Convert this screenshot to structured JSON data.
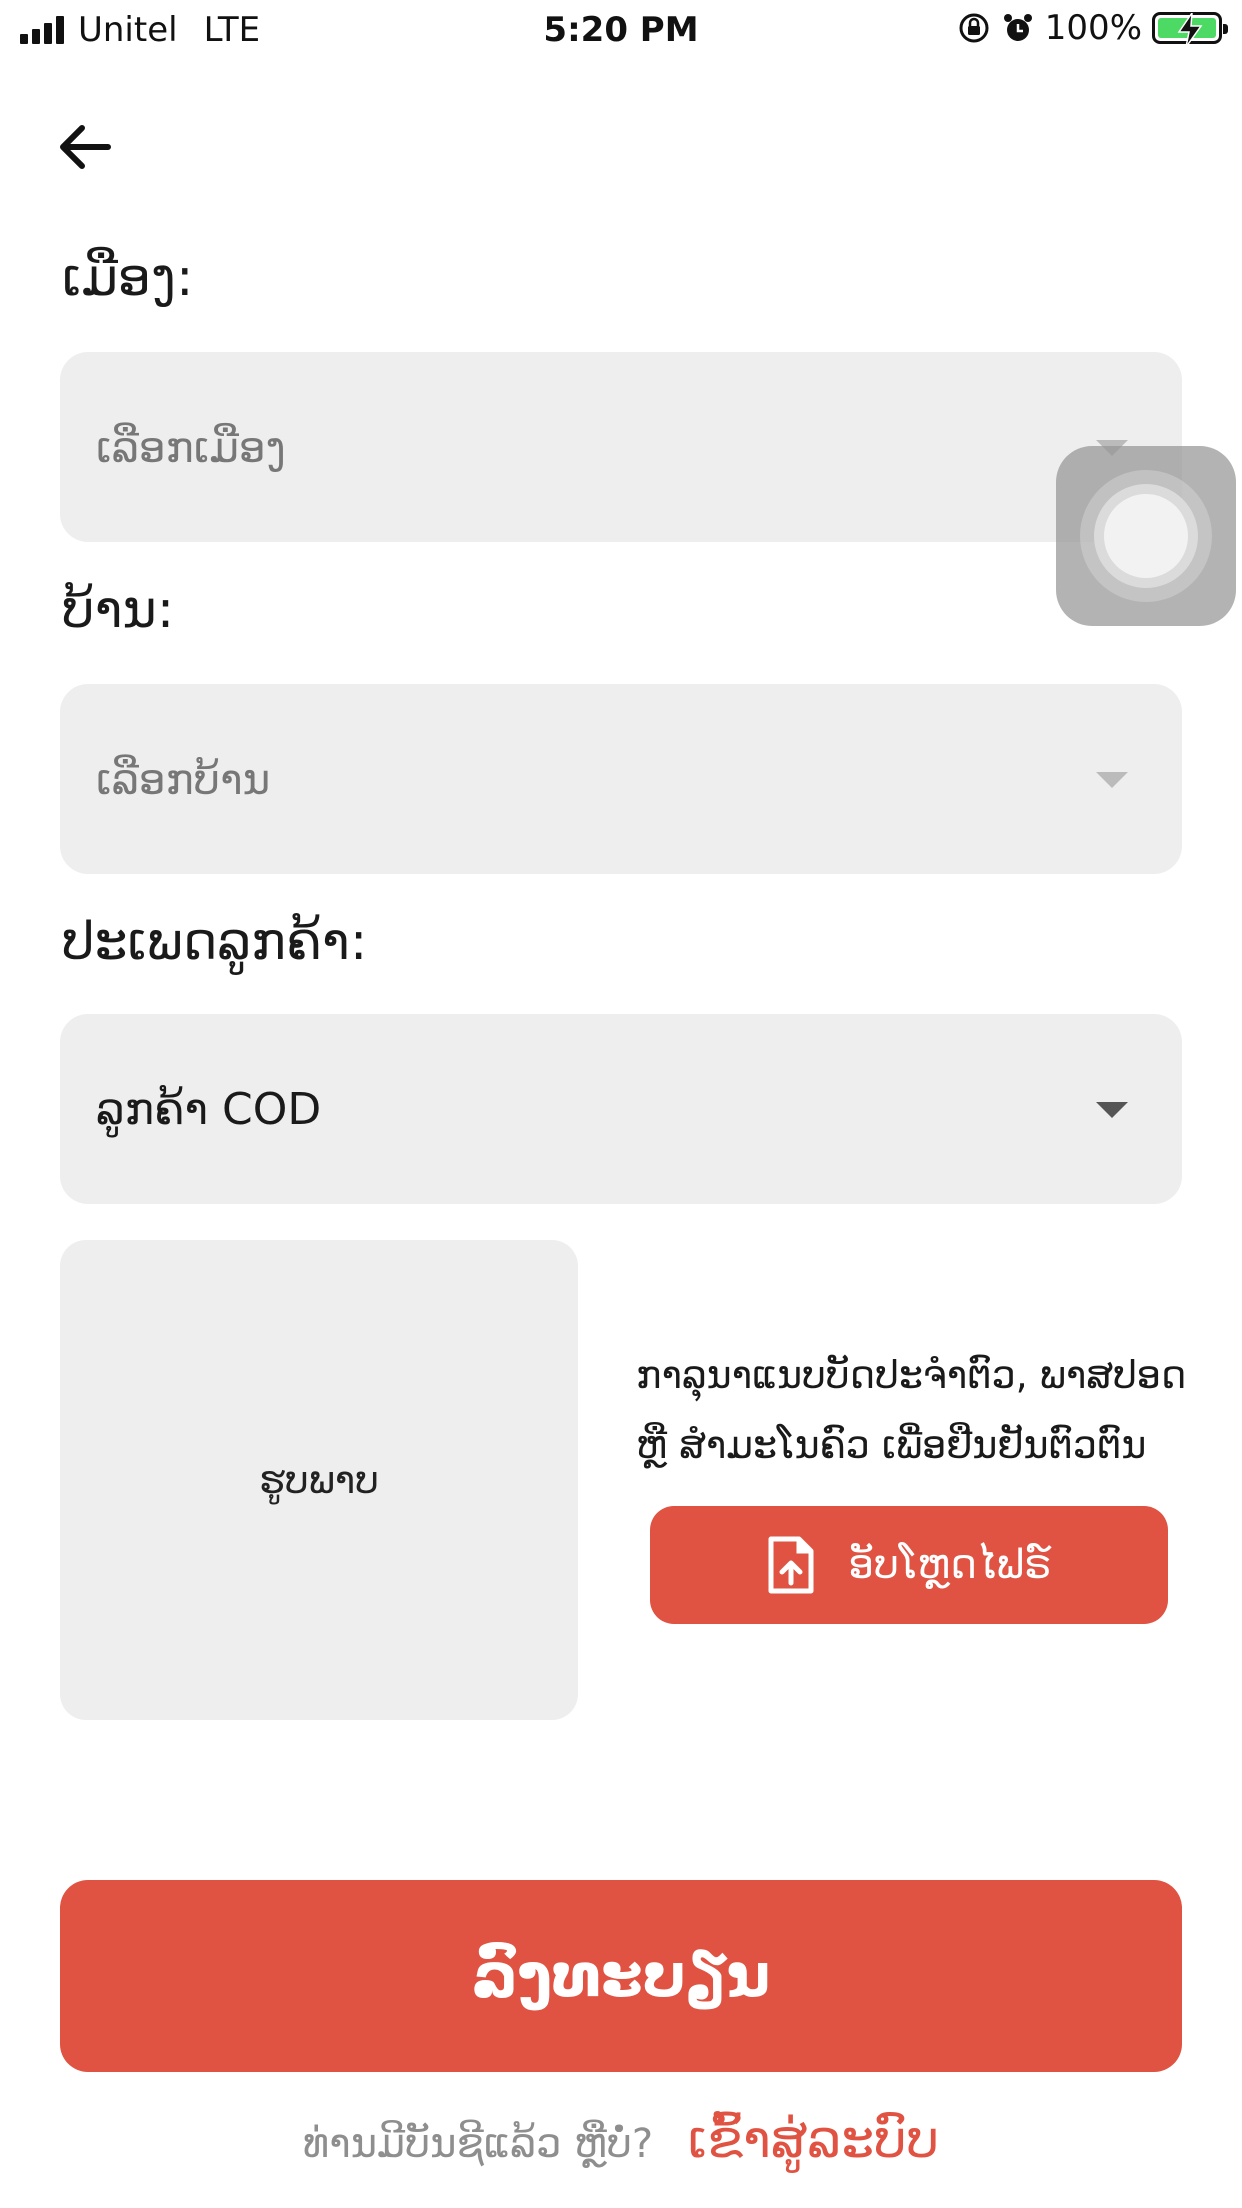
{
  "status_bar": {
    "carrier": "Unitel",
    "network": "LTE",
    "time": "5:20 PM",
    "battery": "100%"
  },
  "form": {
    "district": {
      "label": "ເມືອງ:",
      "placeholder": "ເລືອກເມືອງ"
    },
    "village": {
      "label": "ບ້ານ:",
      "placeholder": "ເລືອກບ້ານ"
    },
    "customer_type": {
      "label": "ປະເພດລູກຄ້າ:",
      "value": "ລູກຄ້າ COD"
    },
    "image": {
      "box_label": "ຮູບພາບ",
      "hint_line1": "ກາລຸນາແນບບັດປະຈຳຕົວ, ພາສປອດ",
      "hint_line2": "ຫຼື ສຳມະໂນຄົວ ເພື່ອຢືນຢັນຕົວຕົນ",
      "upload_label": "ອັບໂຫຼດໄຟຣ໌"
    },
    "register_label": "ລົງທະບຽນ"
  },
  "footer": {
    "question": "ທ່ານມີບັນຊີແລ້ວ ຫຼືບໍ່?",
    "login_link": "ເຂົ້າສູ່ລະບົບ"
  },
  "colors": {
    "accent": "#e05242",
    "field_bg": "#eeeeee"
  }
}
